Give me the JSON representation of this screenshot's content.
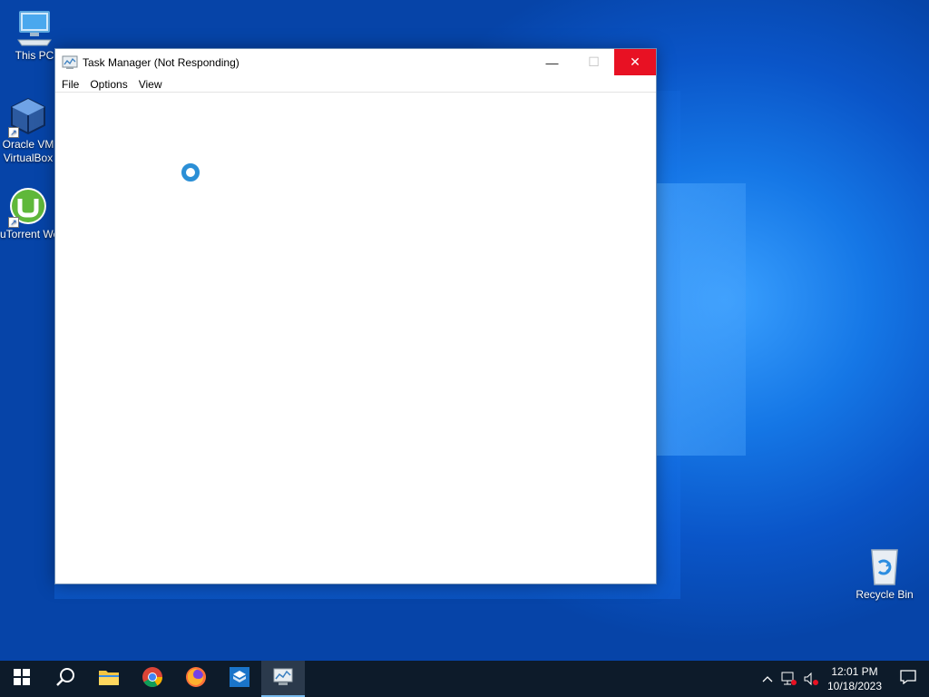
{
  "desktop": {
    "icons": [
      {
        "label": "This PC",
        "icon": "computer-icon"
      },
      {
        "label": "Oracle VM VirtualBox",
        "line1": "Oracle VM",
        "line2": "VirtualBox",
        "icon": "virtualbox-icon"
      },
      {
        "label": "uTorrent Web",
        "line1": "uTorrent Web",
        "icon": "utorrent-icon"
      },
      {
        "label": "Recycle Bin",
        "icon": "recycle-bin-icon"
      }
    ]
  },
  "window": {
    "title": "Task Manager (Not Responding)",
    "menu": [
      "File",
      "Options",
      "View"
    ],
    "controls": {
      "minimize": "—",
      "maximize": "☐",
      "close": "✕"
    }
  },
  "taskbar": {
    "pinned": [
      {
        "name": "start-button",
        "icon": "windows-logo-icon"
      },
      {
        "name": "search-button",
        "icon": "search-icon"
      },
      {
        "name": "file-explorer",
        "icon": "folder-icon"
      },
      {
        "name": "chrome",
        "icon": "chrome-icon"
      },
      {
        "name": "firefox",
        "icon": "firefox-icon"
      },
      {
        "name": "virtualbox",
        "icon": "virtualbox-icon"
      },
      {
        "name": "task-manager",
        "icon": "task-manager-icon",
        "active": true
      }
    ],
    "tray": {
      "time": "12:01 PM",
      "date": "10/18/2023"
    }
  },
  "colors": {
    "close_button": "#e81123",
    "taskbar": "#0d1b2a",
    "accent": "#76b9ed"
  }
}
